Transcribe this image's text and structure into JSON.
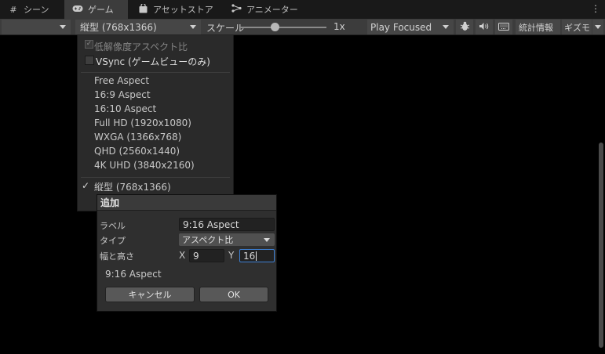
{
  "tabs": [
    {
      "label": "シーン",
      "icon": "grid-icon"
    },
    {
      "label": "ゲーム",
      "icon": "gamepad-icon"
    },
    {
      "label": "アセットストア",
      "icon": "bag-icon"
    },
    {
      "label": "アニメーター",
      "icon": "animator-icon"
    }
  ],
  "toolbar": {
    "display_value": "",
    "aspect_value": "縦型 (768x1366)",
    "scale_label": "スケール",
    "scale_value": "1x",
    "scale_level": 0.4,
    "play_mode": "Play Focused",
    "stats_label": "統計情報",
    "gizmos_label": "ギズモ"
  },
  "aspect_menu": {
    "low_res_label": "低解像度アスペクト比",
    "vsync_label": "VSync (ゲームビューのみ)",
    "options": [
      "Free Aspect",
      "16:9 Aspect",
      "16:10 Aspect",
      "Full HD (1920x1080)",
      "WXGA (1366x768)",
      "QHD (2560x1440)",
      "4K UHD (3840x2160)"
    ],
    "custom_selected": "縦型 (768x1366)",
    "check_mark": "✓"
  },
  "add_dialog": {
    "title": "追加",
    "label_caption": "ラベル",
    "label_value": "9:16 Aspect",
    "type_caption": "タイプ",
    "type_value": "アスペクト比",
    "size_caption": "幅と高さ",
    "x_caption": "X",
    "x_value": "9",
    "y_caption": "Y",
    "y_value": "16",
    "preview": "9:16 Aspect",
    "cancel_label": "キャンセル",
    "ok_label": "OK"
  },
  "colors": {
    "background": "#000000",
    "toolbar": "#3c3c3c",
    "menu": "#2a2a2a",
    "focus_border": "#3d7fd1"
  }
}
